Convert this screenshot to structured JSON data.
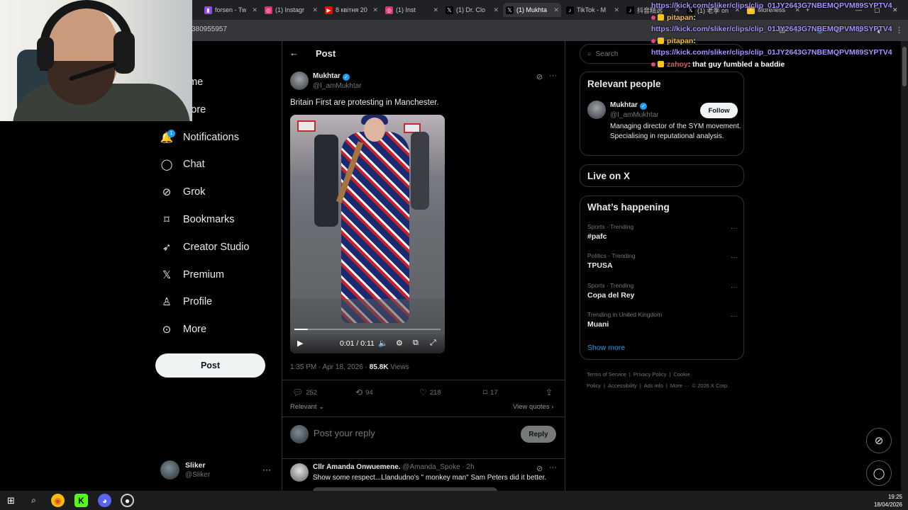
{
  "browser": {
    "tabs": [
      {
        "title": "forsen - Tw",
        "color": "#9146ff",
        "glyph": "▮"
      },
      {
        "title": "(1) Instagr",
        "color": "#e1306c",
        "glyph": "◎"
      },
      {
        "title": "8 квітня 20",
        "color": "#ff0000",
        "glyph": "▶"
      },
      {
        "title": "(1) Inst",
        "color": "#e1306c",
        "glyph": "◎"
      },
      {
        "title": "(1) Dr. Clo",
        "color": "#000000",
        "glyph": "𝕏"
      },
      {
        "title": "(1) Mukhta",
        "color": "#000000",
        "glyph": "𝕏",
        "active": true
      },
      {
        "title": "TikTok - M",
        "color": "#000000",
        "glyph": "♪"
      },
      {
        "title": "抖音精选",
        "color": "#000000",
        "glyph": "♪"
      },
      {
        "title": "(1) 老季 on",
        "color": "#000000",
        "glyph": "𝕏"
      },
      {
        "title": "More/less",
        "color": "#f5c518",
        "glyph": "<"
      }
    ],
    "url_fragment": "380955957"
  },
  "chat": {
    "lines": [
      {
        "type": "link",
        "text": "https://kick.com/sliker/clips/clip_01JY2643G7NBEMQPVM89SYPTV4"
      },
      {
        "type": "msg",
        "user": "pitapan",
        "user_color": "#f0c040",
        "text": ":"
      },
      {
        "type": "link",
        "text": "https://kick.com/sliker/clips/clip_01JY2643G7NBEMQPVM89SYPTV4"
      },
      {
        "type": "msg",
        "user": "pitapan",
        "user_color": "#f0c040",
        "text": ":"
      },
      {
        "type": "link",
        "text": "https://kick.com/sliker/clips/clip_01JY2643G7NBEMQPVM89SYPTV4"
      },
      {
        "type": "msg",
        "user": "zahoy",
        "user_color": "#e05a5a",
        "text": ": that guy fumbled a baddie"
      }
    ]
  },
  "nav": {
    "items": [
      {
        "label": "ome",
        "icon": "home-icon",
        "glyph": "⌂"
      },
      {
        "label": "plore",
        "icon": "search-icon",
        "glyph": "⌕"
      },
      {
        "label": "Notifications",
        "icon": "bell-icon",
        "glyph": "🔔"
      },
      {
        "label": "Chat",
        "icon": "chat-icon",
        "glyph": "◯"
      },
      {
        "label": "Grok",
        "icon": "grok-icon",
        "glyph": "⊘"
      },
      {
        "label": "Bookmarks",
        "icon": "bookmark-icon",
        "glyph": "⌑"
      },
      {
        "label": "Creator Studio",
        "icon": "rocket-icon",
        "glyph": "➶"
      },
      {
        "label": "Premium",
        "icon": "x-logo-icon",
        "glyph": "𝕏"
      },
      {
        "label": "Profile",
        "icon": "person-icon",
        "glyph": "♙"
      },
      {
        "label": "More",
        "icon": "more-circle-icon",
        "glyph": "⊙"
      }
    ],
    "notification_count": "1",
    "post_button": "Post",
    "account": {
      "name": "Sliker",
      "handle": "@Sliker"
    }
  },
  "post": {
    "header_title": "Post",
    "author_name": "Mukhtar",
    "author_handle": "@I_amMukhtar",
    "text": "Britain First are protesting in Manchester.",
    "video": {
      "time": "0:01 / 0:11",
      "progress": 0.09
    },
    "timestamp": "1:35 PM · Apr 18, 2026 · ",
    "views_count": "85.8K",
    "views_label": " Views",
    "stats": {
      "replies": "252",
      "reposts": "94",
      "likes": "218",
      "bookmarks": "17"
    },
    "sort_label": "Relevant",
    "view_quotes": "View quotes",
    "reply_placeholder": "Post your reply",
    "reply_button": "Reply"
  },
  "comment": {
    "name": "Cllr Amanda Onwuemene.",
    "handle_time": " @Amanda_Spoke · 2h",
    "text": "Show some respect...Llandudno's \" monkey man\" Sam Peters did it better."
  },
  "sidebar": {
    "search_placeholder": "Search",
    "relevant_title": "Relevant people",
    "relevant_person": {
      "name": "Mukhtar",
      "handle": "@I_amMukhtar",
      "follow": "Follow",
      "bio": "Managing director of the SYM movement. Specialising in reputational analysis."
    },
    "live_title": "Live on X",
    "happening_title": "What’s happening",
    "trends": [
      {
        "meta": "Sports · Trending",
        "topic": "#pafc"
      },
      {
        "meta": "Politics · Trending",
        "topic": "TPUSA"
      },
      {
        "meta": "Sports · Trending",
        "topic": "Copa del Rey"
      },
      {
        "meta": "Trending in United Kingdom",
        "topic": "Muani"
      }
    ],
    "show_more": "Show more",
    "footer": [
      "Terms of Service",
      "|",
      "Privacy Policy",
      "|",
      "Cookie Policy",
      "|",
      "Accessibility",
      "|",
      "Ads info",
      "|",
      "More ···",
      "© 2026 X Corp."
    ]
  },
  "taskbar": {
    "time": "19:25",
    "date": "18/04/2026"
  },
  "colors": {
    "accent": "#1d9bf0",
    "bg": "#000000",
    "border": "#2f3336",
    "muted": "#71767b"
  }
}
